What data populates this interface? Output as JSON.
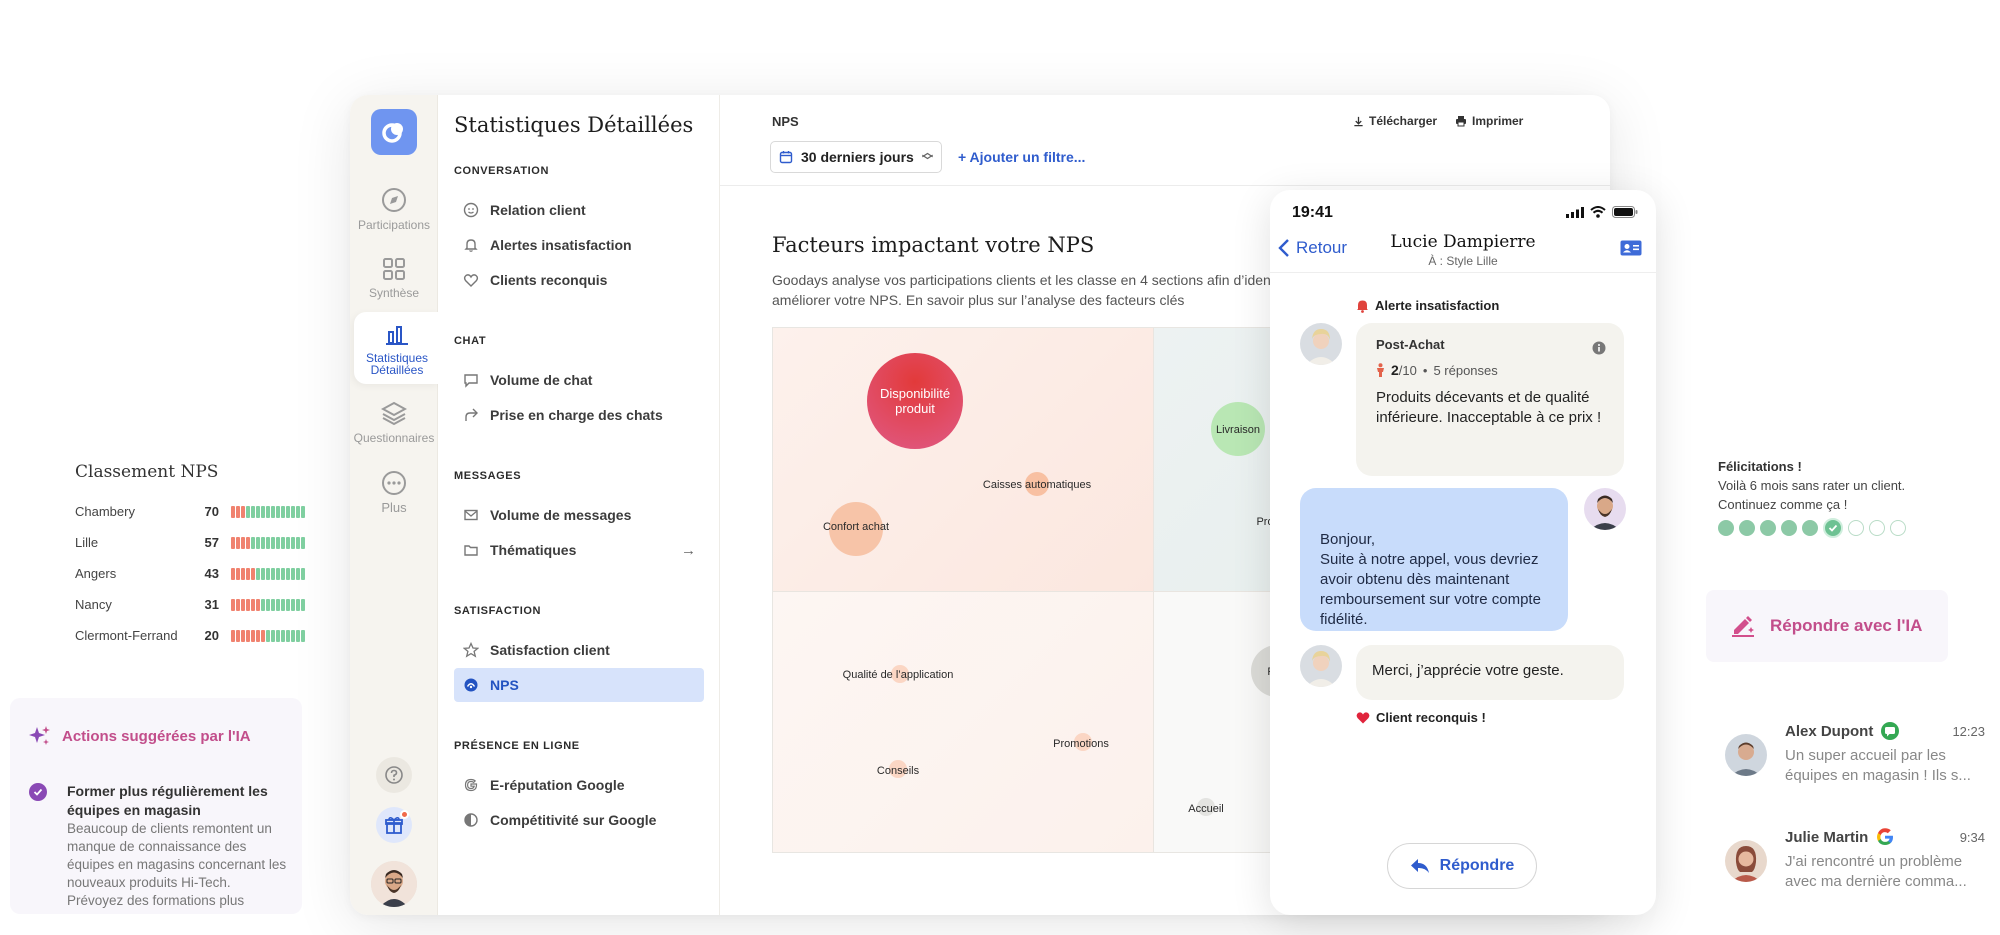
{
  "rail": {
    "items": [
      {
        "label": "Participations",
        "icon": "compass-icon"
      },
      {
        "label": "Synthèse",
        "icon": "grid-icon"
      },
      {
        "label": "Statistiques Détaillées",
        "icon": "bar-chart-icon",
        "active": true
      },
      {
        "label": "Questionnaires",
        "icon": "layers-icon"
      },
      {
        "label": "Plus",
        "icon": "more-icon"
      }
    ]
  },
  "subnav": {
    "title": "Statistiques Détaillées",
    "sections": [
      {
        "label": "CONVERSATION",
        "items": [
          "Relation client",
          "Alertes insatisfaction",
          "Clients reconquis"
        ]
      },
      {
        "label": "CHAT",
        "items": [
          "Volume de chat",
          "Prise en charge des chats"
        ]
      },
      {
        "label": "MESSAGES",
        "items": [
          "Volume de messages",
          "Thématiques"
        ]
      },
      {
        "label": "SATISFACTION",
        "items": [
          "Satisfaction client",
          "NPS"
        ]
      },
      {
        "label": "PRÉSENCE EN LIGNE",
        "items": [
          "E-réputation Google",
          "Compétitivité sur Google"
        ]
      }
    ],
    "active_item": "NPS"
  },
  "content": {
    "breadcrumb": "NPS",
    "download": "Télécharger",
    "print": "Imprimer",
    "date_range": "30 derniers jours",
    "add_filter": "+ Ajouter un filtre...",
    "heading": "Facteurs impactant votre NPS",
    "description": "Goodays analyse vos participations clients et les classe en 4 sections afin d’identi améliorer votre NPS. En savoir plus sur l’analyse des facteurs clés",
    "bubbles": [
      {
        "label": "Disponibilité produit",
        "label_line1": "Disponibilité",
        "label_line2": "produit",
        "quadrant": "top-left",
        "color": "#e0445e"
      },
      {
        "label": "Caisses automatiques",
        "quadrant": "top-left",
        "color": "#f6b898"
      },
      {
        "label": "Confort achat",
        "quadrant": "top-left",
        "color": "#f7c2a6"
      },
      {
        "label": "Livraison",
        "quadrant": "top-right",
        "color": "#b7e6b2"
      },
      {
        "label": "Pro",
        "quadrant": "top-right",
        "color": ""
      },
      {
        "label": "Qualité de l’application",
        "quadrant": "bottom-left",
        "color": "#fbd6c4"
      },
      {
        "label": "Promotions",
        "quadrant": "bottom-left",
        "color": "#fbd6c4"
      },
      {
        "label": "Conseils",
        "quadrant": "bottom-left",
        "color": "#fbd6c4"
      },
      {
        "label": "P",
        "quadrant": "bottom-right",
        "color": "#dcdcd8"
      },
      {
        "label": "Accueil",
        "quadrant": "bottom-right",
        "color": "#e6e6e3"
      }
    ]
  },
  "phone": {
    "time": "19:41",
    "back": "Retour",
    "contact_name": "Lucie Dampierre",
    "contact_sub": "À : Style Lille",
    "alert_label": "Alerte insatisfaction",
    "card_title": "Post-Achat",
    "score": "2",
    "score_suffix": "/10",
    "responses": "5 réponses",
    "card_text": "Produits décevants et de qualité inférieure. Inacceptable à ce prix !",
    "agent_message": "Bonjour,\nSuite à notre appel, vous devriez avoir obtenu dès maintenant remboursement sur votre compte fidélité.",
    "client_reply": "Merci, j’apprécie votre geste.",
    "reconquis": "Client reconquis !",
    "reply_button": "Répondre"
  },
  "ranking": {
    "title": "Classement NPS",
    "rows": [
      {
        "city": "Chambery",
        "value": "70"
      },
      {
        "city": "Lille",
        "value": "57"
      },
      {
        "city": "Angers",
        "value": "43"
      },
      {
        "city": "Nancy",
        "value": "31"
      },
      {
        "city": "Clermont-Ferrand",
        "value": "20"
      }
    ]
  },
  "ai_suggestions": {
    "title": "Actions suggérées par l'IA",
    "item_title": "Former plus régulièrement les équipes en magasin",
    "item_body": "Beaucoup de clients remontent un manque de connaissance des équipes en magasins concernant les nouveaux produits Hi-Tech. Prévoyez des formations plus"
  },
  "congrats": {
    "title": "Félicitations !",
    "line1": "Voilà 6 mois sans rater un client.",
    "line2": "Continuez comme ça !",
    "completed": 6,
    "total": 9
  },
  "ai_reply": {
    "label": "Répondre avec l'IA"
  },
  "conversations": [
    {
      "name": "Alex Dupont",
      "time": "12:23",
      "channel": "sms-icon",
      "message": "Un super accueil par les équipes en magasin ! Ils s..."
    },
    {
      "name": "Julie Martin",
      "time": "9:34",
      "channel": "google-icon",
      "message": "J'ai rencontré un problème avec ma dernière comma..."
    }
  ],
  "colors": {
    "accent_blue": "#2f5ccd",
    "active_nav_bg": "#d7e3fb",
    "ai_pink": "#c24e8b",
    "agent_bubble": "#c8dcfb",
    "client_bubble": "#f4f3ee"
  }
}
